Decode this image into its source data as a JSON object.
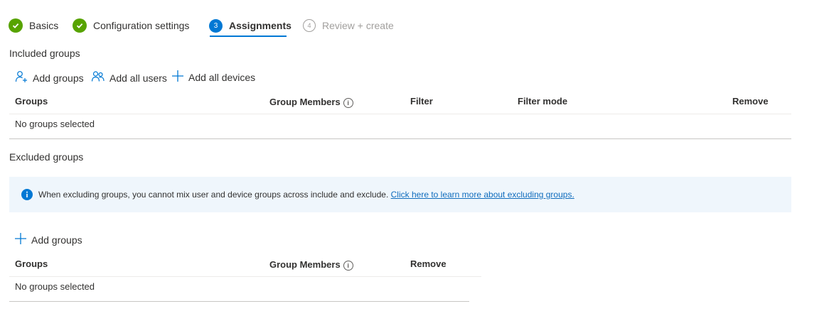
{
  "wizard": {
    "steps": [
      {
        "label": "Basics",
        "status": "done"
      },
      {
        "label": "Configuration settings",
        "status": "done"
      },
      {
        "label": "Assignments",
        "number": "3",
        "status": "active"
      },
      {
        "label": "Review + create",
        "number": "4",
        "status": "pending"
      }
    ]
  },
  "included": {
    "title": "Included groups",
    "commands": {
      "add_groups": "Add groups",
      "add_all_users": "Add all users",
      "add_all_devices": "Add all devices"
    },
    "columns": [
      "Groups",
      "Group Members",
      "Filter",
      "Filter mode",
      "Remove"
    ],
    "empty_text": "No groups selected"
  },
  "excluded": {
    "title": "Excluded groups",
    "info": {
      "text": "When excluding groups, you cannot mix user and device groups across include and exclude.",
      "link": "Click here to learn more about excluding groups."
    },
    "commands": {
      "add_groups": "Add groups"
    },
    "columns": [
      "Groups",
      "Group Members",
      "Remove"
    ],
    "empty_text": "No groups selected"
  },
  "colors": {
    "accent": "#0078d4",
    "success": "#57a300",
    "info_bg": "#eff6fc",
    "link": "#0f6cbd"
  }
}
